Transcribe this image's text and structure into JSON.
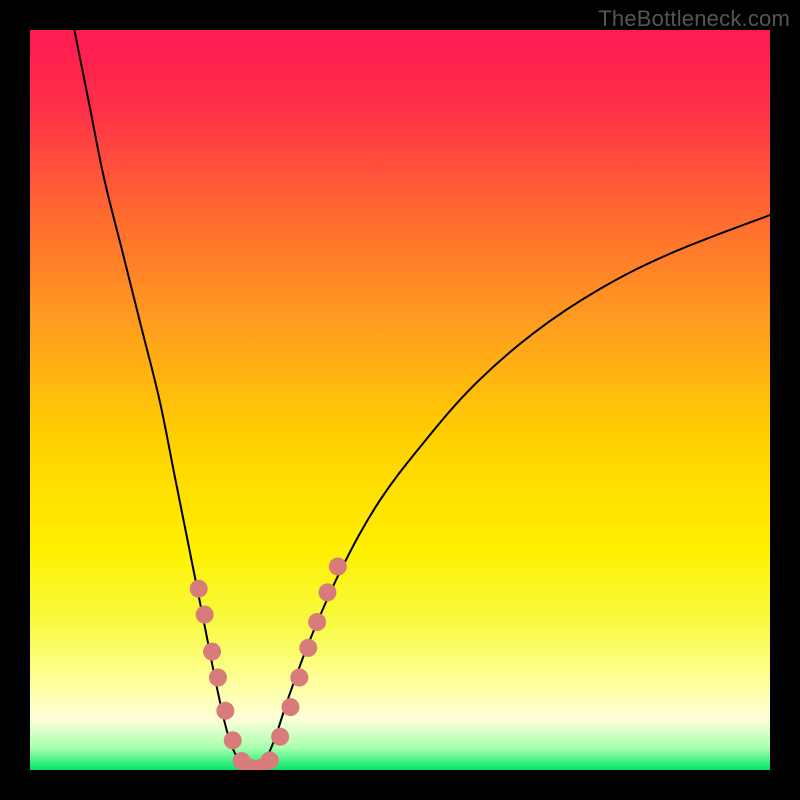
{
  "watermark": "TheBottleneck.com",
  "chart_data": {
    "type": "line",
    "title": "",
    "xlabel": "",
    "ylabel": "",
    "xlim": [
      0,
      100
    ],
    "ylim": [
      0,
      100
    ],
    "background_gradient": {
      "stops": [
        {
          "offset": 0.0,
          "color": "#ff1a52"
        },
        {
          "offset": 0.1,
          "color": "#ff2e49"
        },
        {
          "offset": 0.25,
          "color": "#ff6a30"
        },
        {
          "offset": 0.4,
          "color": "#ff9e1e"
        },
        {
          "offset": 0.55,
          "color": "#ffd000"
        },
        {
          "offset": 0.7,
          "color": "#fff000"
        },
        {
          "offset": 0.8,
          "color": "#f8fa40"
        },
        {
          "offset": 0.88,
          "color": "#ffff9a"
        },
        {
          "offset": 0.93,
          "color": "#ffffd8"
        },
        {
          "offset": 0.97,
          "color": "#a8ffb0"
        },
        {
          "offset": 1.0,
          "color": "#00e668"
        }
      ]
    },
    "series": [
      {
        "name": "curve-left",
        "type": "line",
        "color": "#000000",
        "width": 2,
        "points": [
          {
            "x": 6.0,
            "y": 100.0
          },
          {
            "x": 8.0,
            "y": 90.0
          },
          {
            "x": 10.0,
            "y": 80.0
          },
          {
            "x": 12.5,
            "y": 70.0
          },
          {
            "x": 15.0,
            "y": 60.0
          },
          {
            "x": 17.5,
            "y": 50.0
          },
          {
            "x": 19.5,
            "y": 40.0
          },
          {
            "x": 21.5,
            "y": 30.0
          },
          {
            "x": 23.5,
            "y": 20.0
          },
          {
            "x": 25.5,
            "y": 10.0
          },
          {
            "x": 27.0,
            "y": 4.0
          },
          {
            "x": 28.5,
            "y": 1.0
          },
          {
            "x": 30.0,
            "y": 0.0
          }
        ]
      },
      {
        "name": "curve-right",
        "type": "line",
        "color": "#000000",
        "width": 2,
        "points": [
          {
            "x": 30.0,
            "y": 0.0
          },
          {
            "x": 31.5,
            "y": 1.0
          },
          {
            "x": 33.0,
            "y": 4.0
          },
          {
            "x": 35.0,
            "y": 10.0
          },
          {
            "x": 38.0,
            "y": 18.0
          },
          {
            "x": 42.0,
            "y": 27.0
          },
          {
            "x": 47.0,
            "y": 36.0
          },
          {
            "x": 53.0,
            "y": 44.0
          },
          {
            "x": 60.0,
            "y": 52.0
          },
          {
            "x": 68.0,
            "y": 59.0
          },
          {
            "x": 77.0,
            "y": 65.0
          },
          {
            "x": 87.0,
            "y": 70.0
          },
          {
            "x": 100.0,
            "y": 75.0
          }
        ]
      },
      {
        "name": "dots",
        "type": "scatter",
        "color": "#d87b7b",
        "radius": 9,
        "points": [
          {
            "x": 22.8,
            "y": 24.5
          },
          {
            "x": 23.6,
            "y": 21.0
          },
          {
            "x": 24.6,
            "y": 16.0
          },
          {
            "x": 25.4,
            "y": 12.5
          },
          {
            "x": 26.4,
            "y": 8.0
          },
          {
            "x": 27.4,
            "y": 4.0
          },
          {
            "x": 28.6,
            "y": 1.2
          },
          {
            "x": 29.8,
            "y": 0.3
          },
          {
            "x": 31.2,
            "y": 0.3
          },
          {
            "x": 32.4,
            "y": 1.3
          },
          {
            "x": 33.8,
            "y": 4.5
          },
          {
            "x": 35.2,
            "y": 8.5
          },
          {
            "x": 36.4,
            "y": 12.5
          },
          {
            "x": 37.6,
            "y": 16.5
          },
          {
            "x": 38.8,
            "y": 20.0
          },
          {
            "x": 40.2,
            "y": 24.0
          },
          {
            "x": 41.6,
            "y": 27.5
          }
        ]
      }
    ]
  }
}
